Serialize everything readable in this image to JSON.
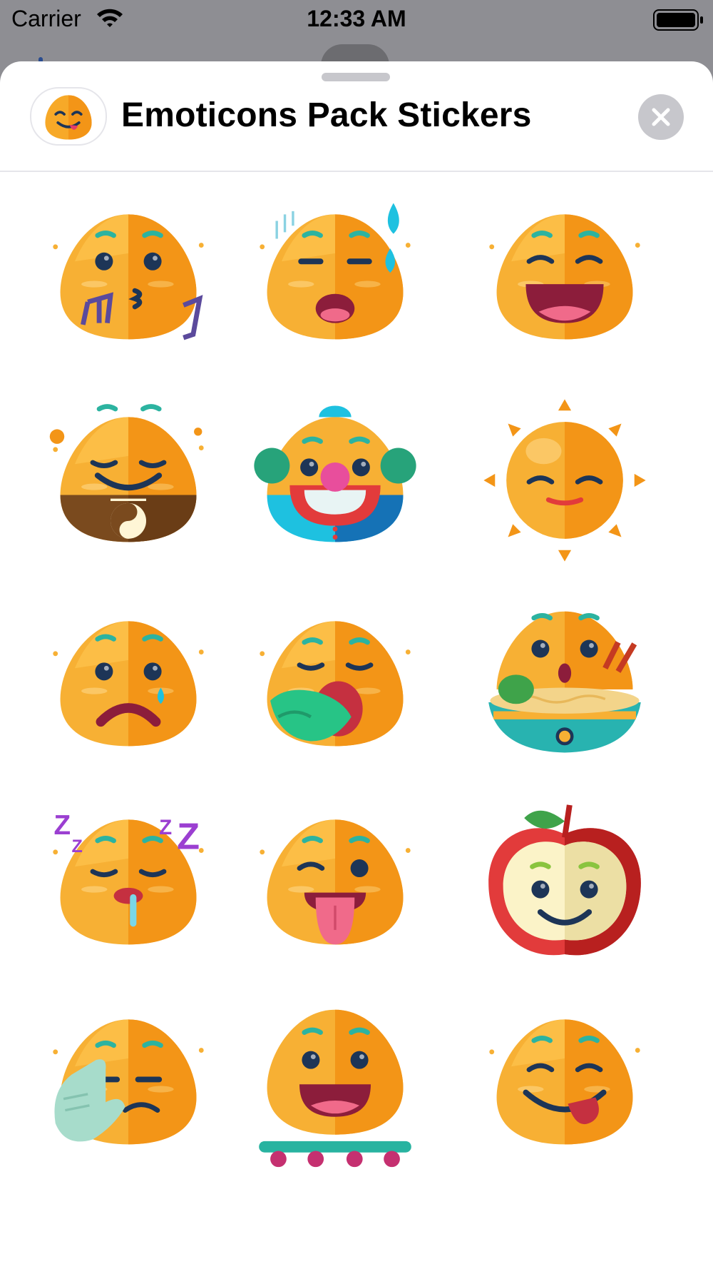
{
  "status_bar": {
    "carrier": "Carrier",
    "time": "12:33 AM"
  },
  "sheet": {
    "title": "Emoticons Pack Stickers",
    "app_icon": "tongue-wink-emoji-icon",
    "close_icon": "close-icon"
  },
  "stickers": [
    {
      "name": "whistling-music-emoji"
    },
    {
      "name": "sweating-sleepy-emoji"
    },
    {
      "name": "laughing-emoji"
    },
    {
      "name": "zen-yin-yang-emoji"
    },
    {
      "name": "clown-emoji"
    },
    {
      "name": "sun-emoji"
    },
    {
      "name": "sad-tear-emoji"
    },
    {
      "name": "vomiting-emoji"
    },
    {
      "name": "noodle-bowl-emoji"
    },
    {
      "name": "sleeping-zzz-emoji"
    },
    {
      "name": "tongue-out-wink-emoji"
    },
    {
      "name": "apple-smiley"
    },
    {
      "name": "hand-face-tired-emoji"
    },
    {
      "name": "skateboard-smile-emoji"
    },
    {
      "name": "tongue-grin-emoji"
    }
  ],
  "colors": {
    "face_left": "#f7b034",
    "face_right": "#f39517",
    "face_top": "#fcc24b",
    "eye": "#1d3557",
    "brow": "#2cb3a0",
    "mouth": "#c53040",
    "tongue": "#f06a8a",
    "close_bg": "#c7c7cc"
  }
}
